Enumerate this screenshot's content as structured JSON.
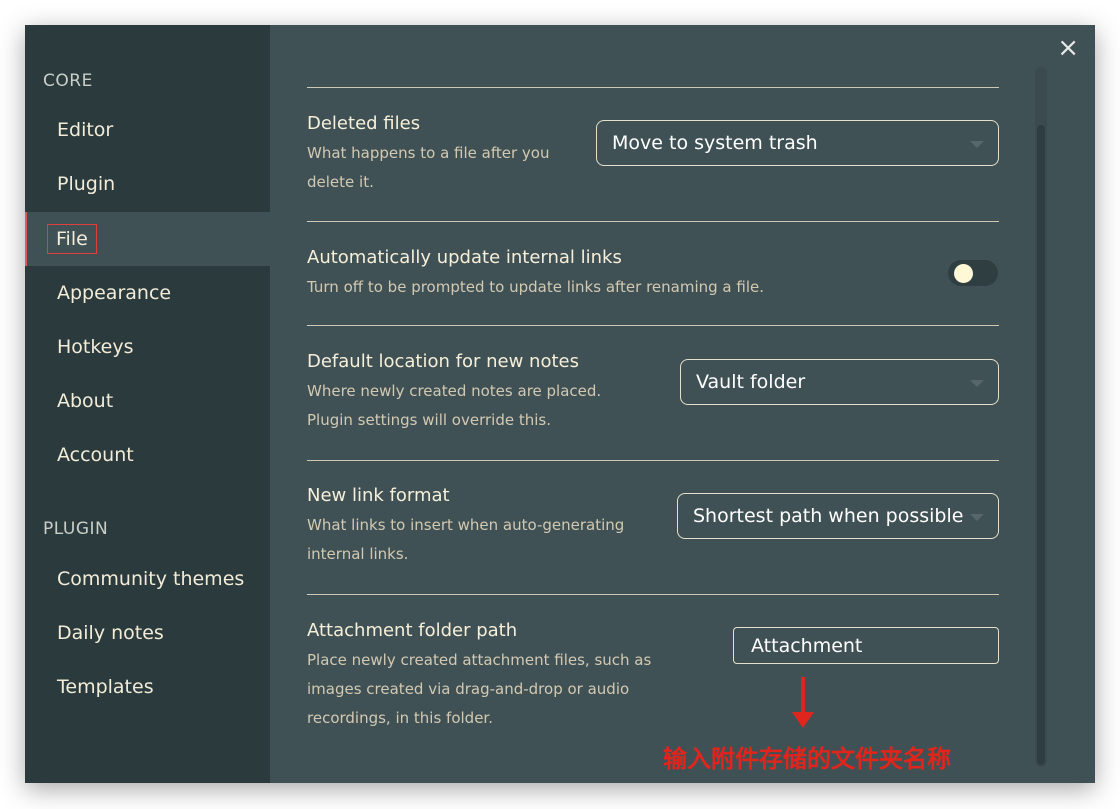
{
  "sidebar": {
    "core_label": "CORE",
    "core_items": [
      "Editor",
      "Plugin",
      "File",
      "Appearance",
      "Hotkeys",
      "About",
      "Account"
    ],
    "plugin_label": "PLUGIN",
    "plugin_items": [
      "Community themes",
      "Daily notes",
      "Templates"
    ],
    "active_item": "File"
  },
  "main": {
    "close_icon": "×",
    "settings": {
      "deleted_files": {
        "name": "Deleted files",
        "desc_line1": "What happens to a file after you",
        "desc_line2": "delete it.",
        "value": "Move to system trash"
      },
      "auto_update_links": {
        "name": "Automatically update internal links",
        "desc": "Turn off to be prompted to update links after renaming a file.",
        "enabled": false
      },
      "default_location": {
        "name": "Default location for new notes",
        "desc_line1": "Where newly created notes are placed.",
        "desc_line2": "Plugin settings will override this.",
        "value": "Vault folder"
      },
      "new_link_format": {
        "name": "New link format",
        "desc_line1": "What links to insert when auto-generating",
        "desc_line2": "internal links.",
        "value": "Shortest path when possible"
      },
      "attachment_folder": {
        "name": "Attachment folder path",
        "desc_line1": "Place newly created attachment files, such as",
        "desc_line2": "images created via drag-and-drop or audio",
        "desc_line3": "recordings, in this folder.",
        "value": "Attachment"
      }
    }
  },
  "annotation": {
    "text": "输入附件存储的文件夹名称",
    "color": "#e0251d"
  },
  "colors": {
    "sidebar_bg": "#2b3a3c",
    "main_bg": "#405155",
    "text": "#f6efd9"
  }
}
